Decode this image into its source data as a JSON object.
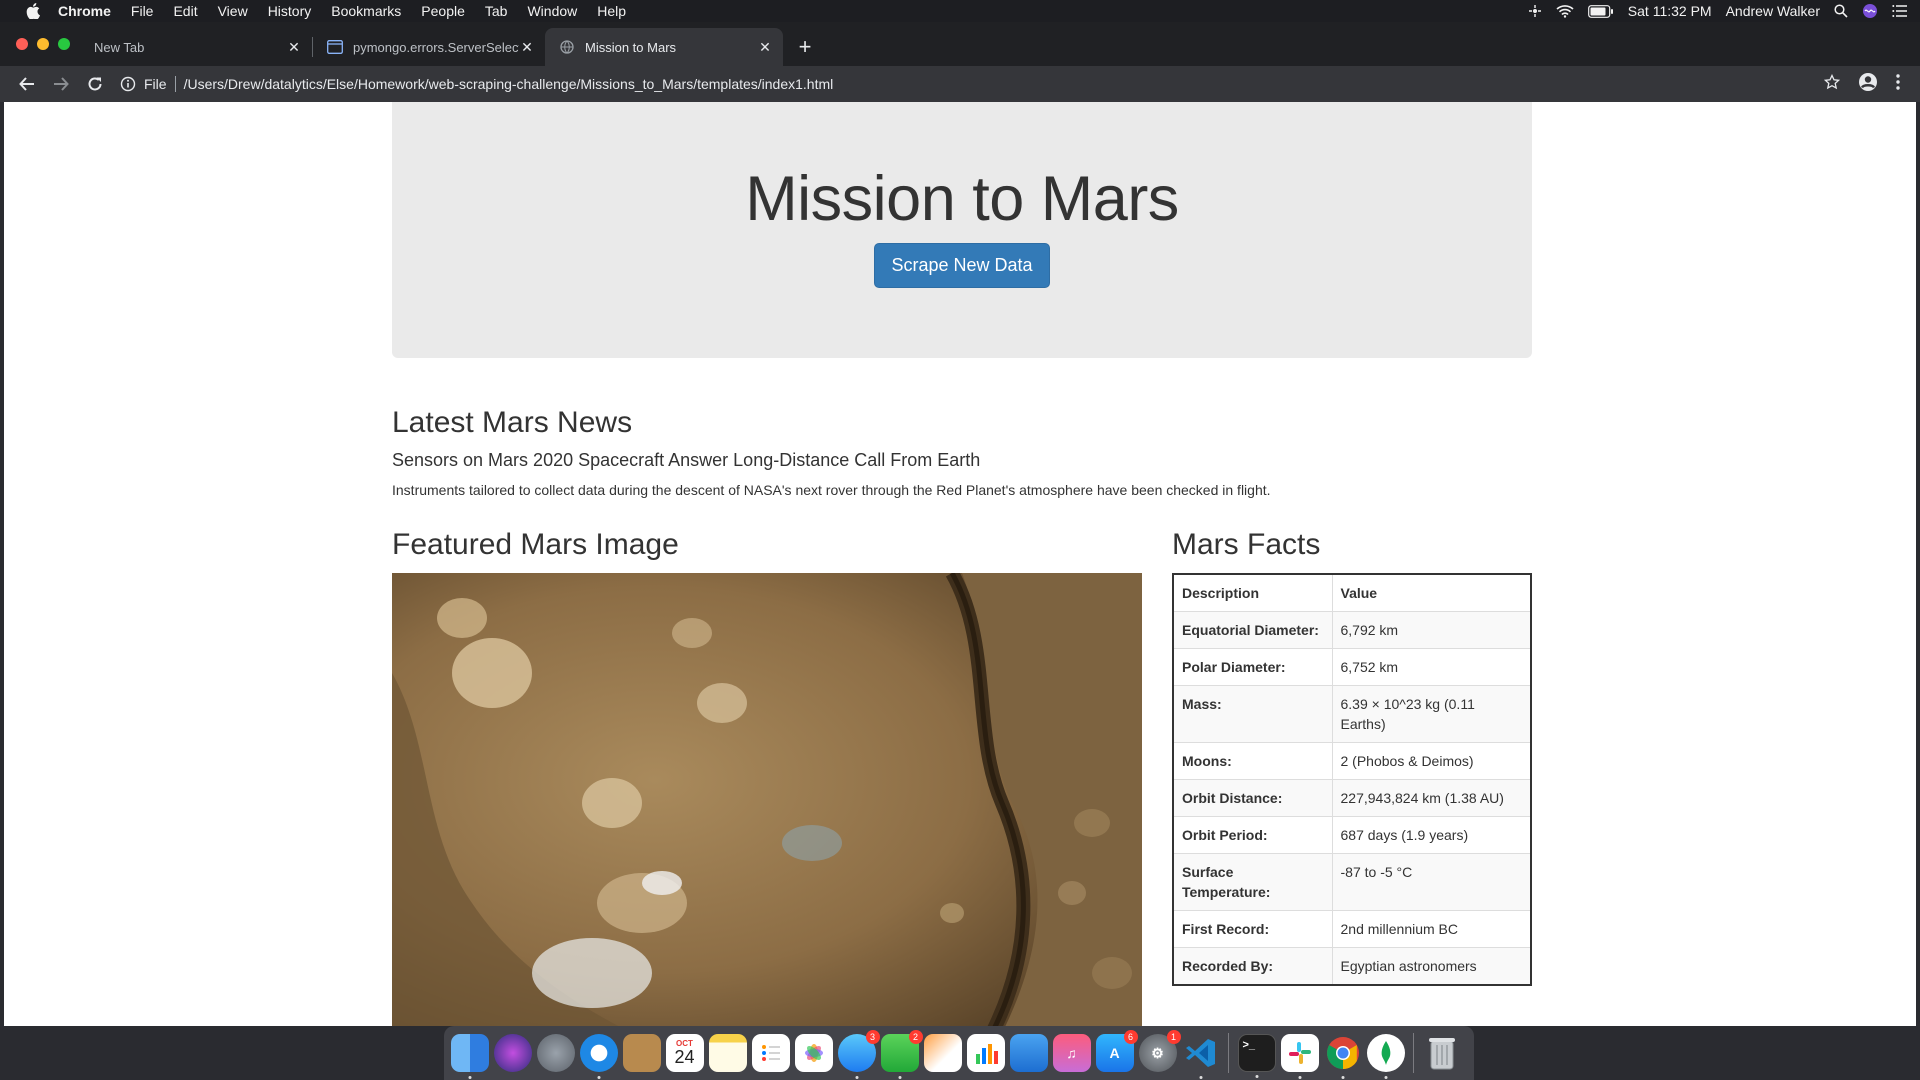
{
  "menubar": {
    "app": "Chrome",
    "items": [
      "File",
      "Edit",
      "View",
      "History",
      "Bookmarks",
      "People",
      "Tab",
      "Window",
      "Help"
    ],
    "clock": "Sat 11:32 PM",
    "user": "Andrew Walker"
  },
  "tabs": [
    {
      "title": "New Tab",
      "active": false
    },
    {
      "title": "pymongo.errors.ServerSelectionTimeoutError",
      "active": false
    },
    {
      "title": "Mission to Mars",
      "active": true
    }
  ],
  "omnibox": {
    "scheme": "File",
    "url": "/Users/Drew/datalytics/Else/Homework/web-scraping-challenge/Missions_to_Mars/templates/index1.html"
  },
  "page": {
    "title": "Mission to Mars",
    "scrape_button": "Scrape New Data",
    "news_section": "Latest Mars News",
    "news_title": "Sensors on Mars 2020 Spacecraft Answer Long-Distance Call From Earth",
    "news_paragraph": "Instruments tailored to collect data during the descent of NASA's next rover through the Red Planet's atmosphere have been checked in flight.",
    "image_section": "Featured Mars Image",
    "facts_section": "Mars Facts",
    "facts_header": [
      "Description",
      "Value"
    ],
    "facts": [
      {
        "key": "Equatorial Diameter:",
        "value": "6,792 km"
      },
      {
        "key": "Polar Diameter:",
        "value": "6,752 km"
      },
      {
        "key": "Mass:",
        "value": "6.39 × 10^23 kg (0.11 Earths)"
      },
      {
        "key": "Moons:",
        "value": "2 (Phobos & Deimos)"
      },
      {
        "key": "Orbit Distance:",
        "value": "227,943,824 km (1.38 AU)"
      },
      {
        "key": "Orbit Period:",
        "value": "687 days (1.9 years)"
      },
      {
        "key": "Surface Temperature:",
        "value": "-87 to -5 °C"
      },
      {
        "key": "First Record:",
        "value": "2nd millennium BC"
      },
      {
        "key": "Recorded By:",
        "value": "Egyptian astronomers"
      }
    ]
  },
  "dock": {
    "calendar_month": "OCT",
    "calendar_day": "24",
    "badges": {
      "messages": "3",
      "facetime": "2",
      "appstore": "6",
      "settings": "1"
    }
  }
}
